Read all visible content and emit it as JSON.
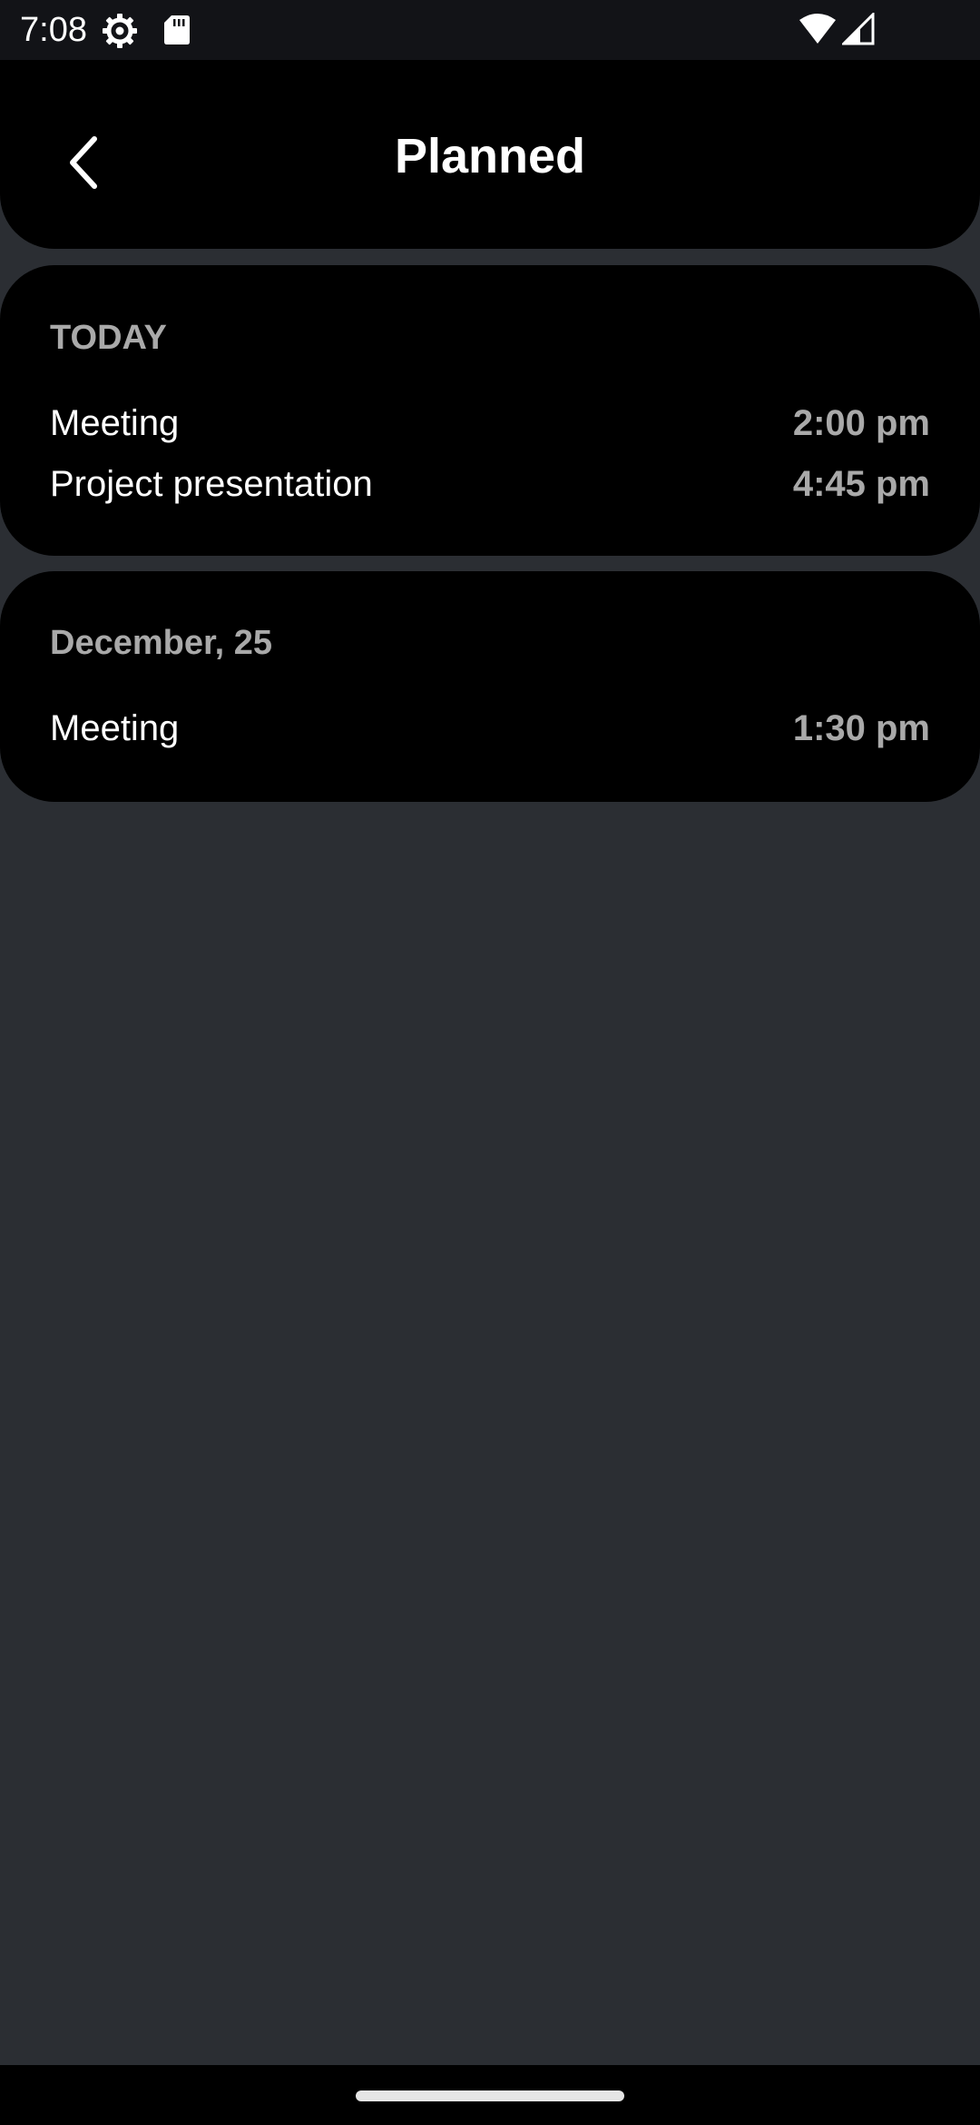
{
  "status_bar": {
    "time": "7:08",
    "icons": [
      "settings-gear-icon",
      "sd-card-icon",
      "wifi-icon",
      "cell-signal-icon"
    ]
  },
  "header": {
    "title": "Planned",
    "back_icon": "chevron-left-icon"
  },
  "sections": [
    {
      "label": "TODAY",
      "events": [
        {
          "title": "Meeting",
          "time": "2:00 pm"
        },
        {
          "title": "Project presentation",
          "time": "4:45 pm"
        }
      ]
    },
    {
      "label": "December, 25",
      "events": [
        {
          "title": "Meeting",
          "time": "1:30 pm"
        }
      ]
    }
  ],
  "colors": {
    "background": "#2b2e33",
    "surface": "#000000",
    "status_bar": "#121317",
    "primary_text": "#ffffff",
    "secondary_text": "#a9a9a9"
  }
}
